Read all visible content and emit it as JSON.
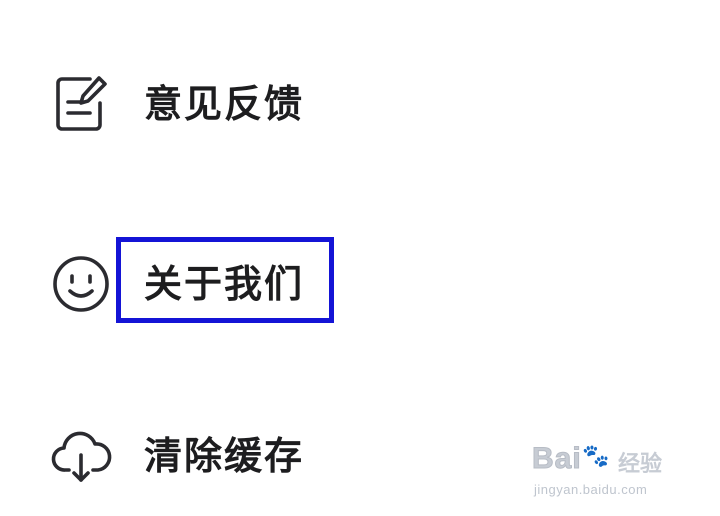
{
  "menu": {
    "items": [
      {
        "label": "意见反馈",
        "icon": "feedback-edit-icon"
      },
      {
        "label": "关于我们",
        "icon": "smiley-face-icon"
      },
      {
        "label": "清除缓存",
        "icon": "cloud-download-icon"
      }
    ]
  },
  "highlight": {
    "target": "关于我们",
    "color": "#1414d6"
  },
  "watermark": {
    "logo": "Bai",
    "logo_suffix": "经验",
    "url": "jingyan.baidu.com"
  },
  "colors": {
    "text": "#1d1d1f",
    "icon_stroke": "#2b2b30",
    "background": "#ffffff"
  }
}
